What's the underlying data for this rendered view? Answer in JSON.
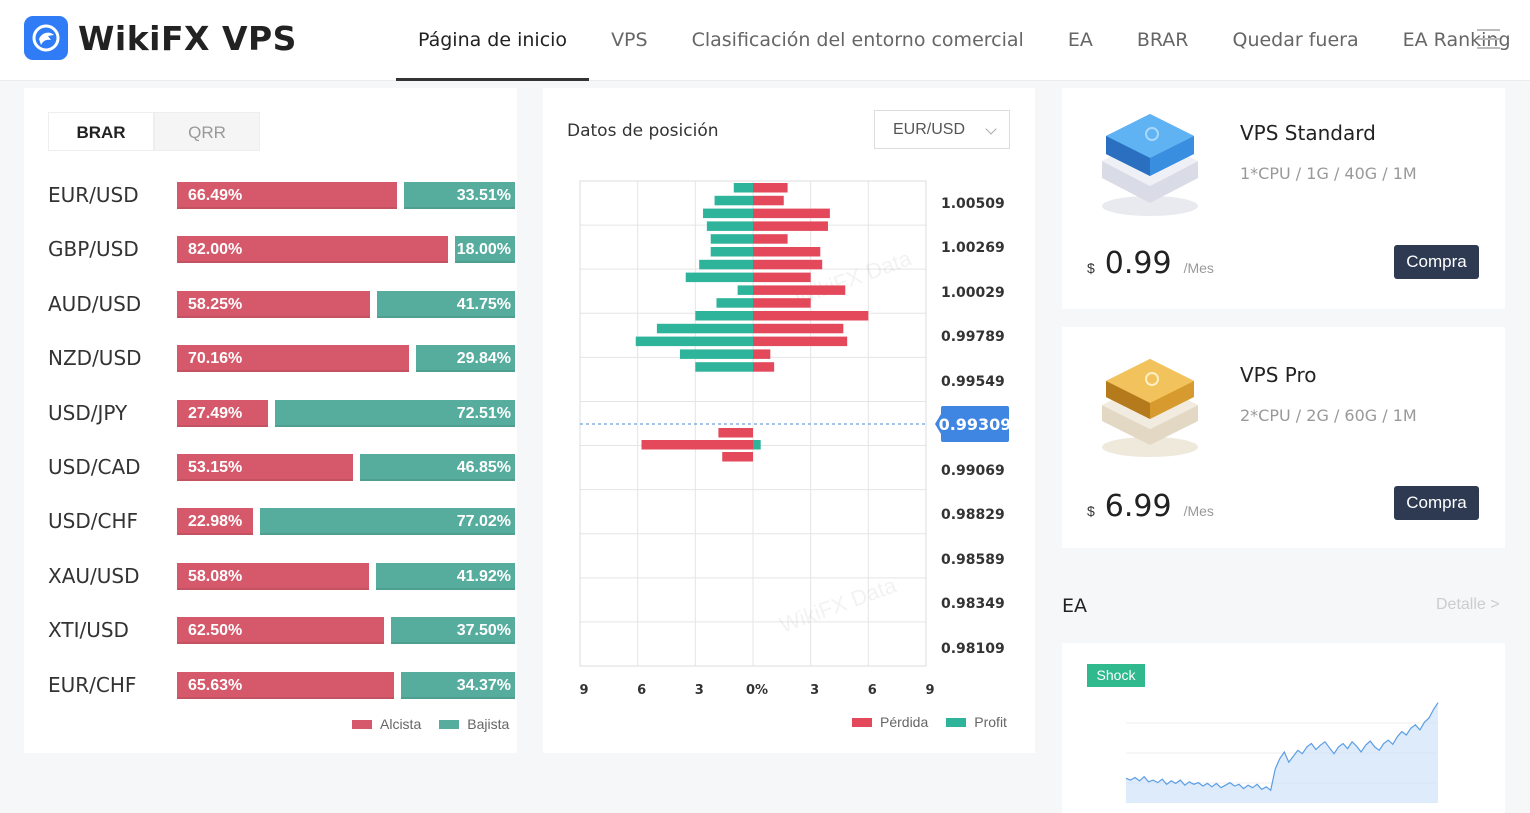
{
  "header": {
    "brand": "WikiFX VPS",
    "nav": [
      {
        "label": "Página de inicio",
        "active": true
      },
      {
        "label": "VPS"
      },
      {
        "label": "Clasificación del entorno comercial"
      },
      {
        "label": "EA"
      },
      {
        "label": "BRAR"
      },
      {
        "label": "Quedar fuera"
      },
      {
        "label": "EA Ranking"
      }
    ]
  },
  "brar_panel": {
    "tabs": [
      "BRAR",
      "QRR"
    ],
    "active_tab": "BRAR",
    "rows": [
      {
        "pair": "EUR/USD",
        "bull": "66.49%",
        "bear": "33.51%"
      },
      {
        "pair": "GBP/USD",
        "bull": "82.00%",
        "bear": "18.00%"
      },
      {
        "pair": "AUD/USD",
        "bull": "58.25%",
        "bear": "41.75%"
      },
      {
        "pair": "NZD/USD",
        "bull": "70.16%",
        "bear": "29.84%"
      },
      {
        "pair": "USD/JPY",
        "bull": "27.49%",
        "bear": "72.51%"
      },
      {
        "pair": "USD/CAD",
        "bull": "53.15%",
        "bear": "46.85%"
      },
      {
        "pair": "USD/CHF",
        "bull": "22.98%",
        "bear": "77.02%"
      },
      {
        "pair": "XAU/USD",
        "bull": "58.08%",
        "bear": "41.92%"
      },
      {
        "pair": "XTI/USD",
        "bull": "62.50%",
        "bear": "37.50%"
      },
      {
        "pair": "EUR/CHF",
        "bull": "65.63%",
        "bear": "34.37%"
      }
    ],
    "legend": {
      "bull": "Alcista",
      "bear": "Bajista"
    },
    "colors": {
      "bull": "#d5596b",
      "bear": "#56ad9d"
    }
  },
  "position_panel": {
    "title": "Datos de posición",
    "selected_pair": "EUR/USD",
    "legend": {
      "loss": "Pérdida",
      "profit": "Profit"
    },
    "watermark": "WikiFX Data"
  },
  "chart_data": {
    "type": "bar",
    "orientation": "horizontal-diverging",
    "x_ticks": [
      "9",
      "6",
      "3",
      "0%",
      "3",
      "6",
      "9"
    ],
    "xlim": [
      -9,
      9
    ],
    "y_labels": [
      "1.00509",
      "1.00269",
      "1.00029",
      "0.99789",
      "0.99549",
      "0.99069",
      "0.98829",
      "0.98589",
      "0.98349",
      "0.98109"
    ],
    "current_price": "0.99309",
    "series": [
      {
        "name": "Pérdida",
        "color": "#e4495b"
      },
      {
        "name": "Profit",
        "color": "#2eb49a"
      }
    ],
    "rows_above": [
      {
        "profit": 1.0,
        "loss": 1.8
      },
      {
        "profit": 2.0,
        "loss": 1.6
      },
      {
        "profit": 2.6,
        "loss": 4.0
      },
      {
        "profit": 2.4,
        "loss": 3.9
      },
      {
        "profit": 2.2,
        "loss": 1.8
      },
      {
        "profit": 2.2,
        "loss": 3.5
      },
      {
        "profit": 2.8,
        "loss": 3.6
      },
      {
        "profit": 3.5,
        "loss": 3.0
      },
      {
        "profit": 0.8,
        "loss": 4.8
      },
      {
        "profit": 1.9,
        "loss": 3.0
      },
      {
        "profit": 3.0,
        "loss": 6.0
      },
      {
        "profit": 5.0,
        "loss": 4.7
      },
      {
        "profit": 6.1,
        "loss": 4.9
      },
      {
        "profit": 3.8,
        "loss": 0.9
      },
      {
        "profit": 3.0,
        "loss": 1.1
      }
    ],
    "rows_below": [
      {
        "loss_left": 1.8,
        "profit_right": 0
      },
      {
        "loss_left": 5.8,
        "profit_right": 0.4
      },
      {
        "loss_left": 1.6,
        "profit_right": 0
      }
    ]
  },
  "vps": [
    {
      "name": "VPS Standard",
      "spec": "1*CPU / 1G / 40G / 1M",
      "currency": "$",
      "price": "0.99",
      "unit": "/Mes",
      "buy": "Compra"
    },
    {
      "name": "VPS Pro",
      "spec": "2*CPU / 2G / 60G / 1M",
      "currency": "$",
      "price": "6.99",
      "unit": "/Mes",
      "buy": "Compra"
    }
  ],
  "ea": {
    "title": "EA",
    "detail": "Detalle >",
    "badge": "Shock",
    "spark": [
      29,
      27,
      30,
      26,
      31,
      25,
      27,
      24,
      28,
      22,
      26,
      23,
      27,
      21,
      25,
      22,
      24,
      20,
      23,
      19,
      23,
      18,
      21,
      24,
      20,
      22,
      17,
      21,
      18,
      22,
      16,
      19,
      15,
      40,
      52,
      60,
      48,
      55,
      62,
      58,
      66,
      70,
      63,
      68,
      72,
      65,
      58,
      66,
      70,
      64,
      72,
      67,
      60,
      68,
      73,
      66,
      62,
      70,
      74,
      69,
      78,
      84,
      80,
      88,
      92,
      86,
      95,
      100,
      110,
      118
    ]
  }
}
